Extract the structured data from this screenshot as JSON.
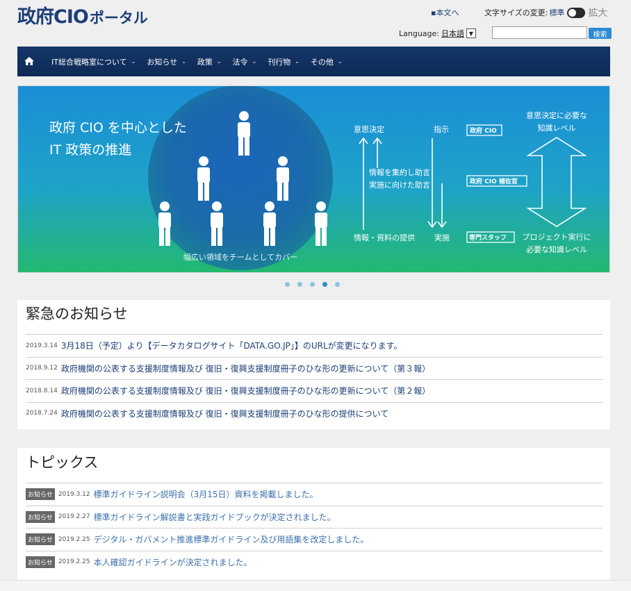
{
  "header": {
    "logo": "政府CIO",
    "logo_sub": "ポータル",
    "skip_link": "本文へ",
    "font_size_label": "文字サイズの変更:",
    "font_size_standard": "標準",
    "font_size_large": "拡大",
    "language_label": "Language:",
    "language_value": "日本語",
    "search_button": "検索"
  },
  "nav": {
    "home_icon": "home-icon",
    "items": [
      {
        "label": "IT総合戦略室について"
      },
      {
        "label": "お知らせ"
      },
      {
        "label": "政策"
      },
      {
        "label": "法令"
      },
      {
        "label": "刊行物"
      },
      {
        "label": "その他"
      }
    ]
  },
  "banner": {
    "title_line1": "政府 CIO を中心とした",
    "title_line2": "IT 政策の推進",
    "caption_bottom": "幅広い領域をチームとしてカバー",
    "decision": "意思決定",
    "instruction": "指示",
    "aggregate_line1": "情報を集約し助言",
    "aggregate_line2": "実施に向けた助言",
    "info_provide": "情報・資料の提供",
    "implement": "実施",
    "role_cio": "政府 CIO",
    "role_assistant": "政府 CIO 補佐官",
    "role_staff": "専門スタッフ",
    "knowledge_top_line1": "意思決定に必要な",
    "knowledge_top_line2": "知識レベル",
    "knowledge_bottom_line1": "プロジェクト実行に",
    "knowledge_bottom_line2": "必要な知識レベル",
    "slide_count": 5,
    "active_slide": 4
  },
  "emergency": {
    "title": "緊急のお知らせ",
    "items": [
      {
        "date": "2019.3.14",
        "text": "3月18日（予定）より【データカタログサイト「DATA.GO.JP」】のURLが変更になります。"
      },
      {
        "date": "2018.9.12",
        "text": "政府機関の公表する支援制度情報及び 復旧・復興支援制度冊子のひな形の更新について（第３報）"
      },
      {
        "date": "2018.8.14",
        "text": "政府機関の公表する支援制度情報及び 復旧・復興支援制度冊子のひな形の更新について（第２報）"
      },
      {
        "date": "2018.7.24",
        "text": "政府機関の公表する支援制度情報及び 復旧・復興支援制度冊子のひな形の提供について"
      }
    ]
  },
  "topics": {
    "title": "トピックス",
    "items": [
      {
        "tag": "お知らせ",
        "date": "2019.3.12",
        "text": "標準ガイドライン説明会（3月15日）資料を掲載しました。"
      },
      {
        "tag": "お知らせ",
        "date": "2019.2.27",
        "text": "標準ガイドライン解説書と実践ガイドブックが決定されました。"
      },
      {
        "tag": "お知らせ",
        "date": "2019.2.25",
        "text": "デジタル・ガバメント推進標準ガイドライン及び用語集を改定しました。"
      },
      {
        "tag": "お知らせ",
        "date": "2019.2.25",
        "text": "本人確認ガイドラインが決定されました。"
      }
    ]
  }
}
